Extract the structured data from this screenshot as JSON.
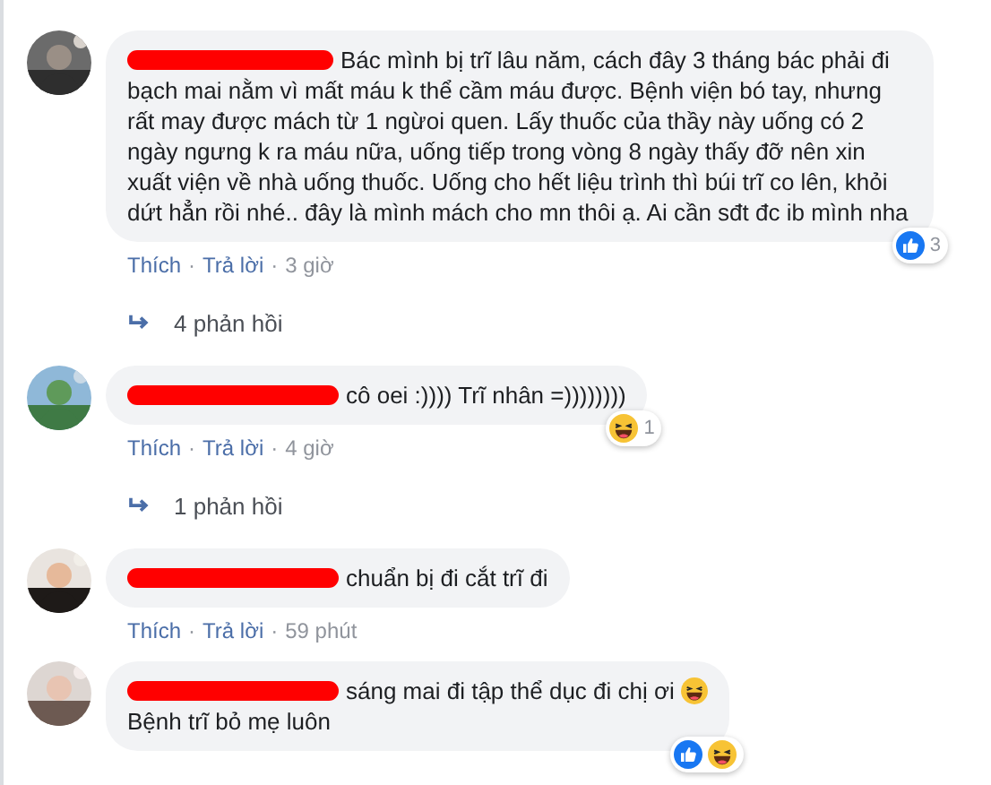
{
  "comments": [
    {
      "redacted": true,
      "lines": [
        "Bác mình bị trĩ lâu năm, cách đây 3 tháng bác phải đi bạch mai nằm vì mất máu k thể cầm máu được. Bệnh viện bó tay, nhưng rất may được mách từ 1 ngừoi quen. Lấy thuốc của thầy này uống có 2 ngày ngưng k ra máu nữa, uống tiếp trong vòng 8 ngày thấy đỡ nên xin xuất viện về nhà uống thuốc. Uống cho hết liệu trình thì búi trĩ co lên, khỏi dứt hẳn rồi nhé.. đây là mình mách cho mn thôi ạ. Ai cần sđt đc ib mình nha"
      ],
      "reactions": {
        "like": true,
        "haha": false,
        "count": "3"
      },
      "meta": [
        {
          "kind": "link",
          "text": "Thích"
        },
        {
          "kind": "sep",
          "text": "·"
        },
        {
          "kind": "link",
          "text": "Trả lời"
        },
        {
          "kind": "sep",
          "text": "·"
        },
        {
          "kind": "time",
          "text": "3 giờ"
        }
      ],
      "replies": "4 phản hồi"
    },
    {
      "redacted": true,
      "lines": [
        "cô oei :)))) Trĩ nhân =))))))))"
      ],
      "reactions": {
        "like": false,
        "haha": true,
        "count": "1"
      },
      "meta": [
        {
          "kind": "link",
          "text": "Thích"
        },
        {
          "kind": "sep",
          "text": "·"
        },
        {
          "kind": "link",
          "text": "Trả lời"
        },
        {
          "kind": "sep",
          "text": "·"
        },
        {
          "kind": "time",
          "text": "4 giờ"
        }
      ],
      "replies": "1 phản hồi"
    },
    {
      "redacted": true,
      "lines": [
        "chuẩn bị đi cắt trĩ đi"
      ],
      "meta": [
        {
          "kind": "link",
          "text": "Thích"
        },
        {
          "kind": "sep",
          "text": "·"
        },
        {
          "kind": "link",
          "text": "Trả lời"
        },
        {
          "kind": "sep",
          "text": "·"
        },
        {
          "kind": "time",
          "text": "59 phút"
        }
      ]
    },
    {
      "redacted": true,
      "lines": [
        "sáng mai đi tập thể dục đi chị ơi",
        "Bệnh trĩ bỏ mẹ luôn"
      ],
      "laughing_emoji": true,
      "reactions": {
        "like": true,
        "haha": true
      }
    }
  ]
}
